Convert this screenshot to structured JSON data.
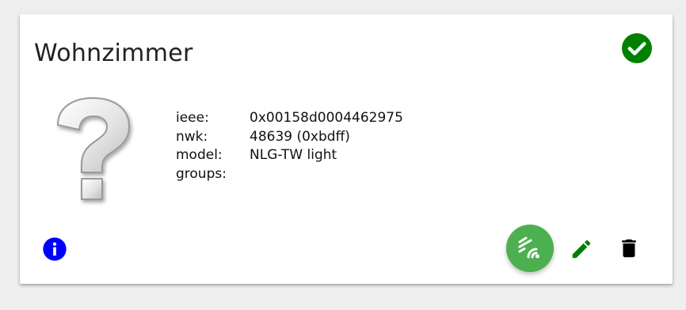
{
  "card": {
    "title": "Wohnzimmer",
    "status_icon": "check-circle-icon",
    "status_color": "#008000",
    "image_icon": "question-mark-icon"
  },
  "info": {
    "rows": [
      {
        "key": "ieee:",
        "value": "0x00158d0004462975"
      },
      {
        "key": "nwk:",
        "value": "48639 (0xbdff)"
      },
      {
        "key": "model:",
        "value": "NLG-TW light"
      },
      {
        "key": "groups:",
        "value": ""
      }
    ]
  },
  "actions": {
    "info_icon": "info-icon",
    "info_color": "#0000ff",
    "fab_icon": "signal-icon",
    "fab_color": "#4caf50",
    "edit_icon": "pencil-icon",
    "edit_color": "#008000",
    "delete_icon": "trash-icon",
    "delete_color": "#000000"
  }
}
